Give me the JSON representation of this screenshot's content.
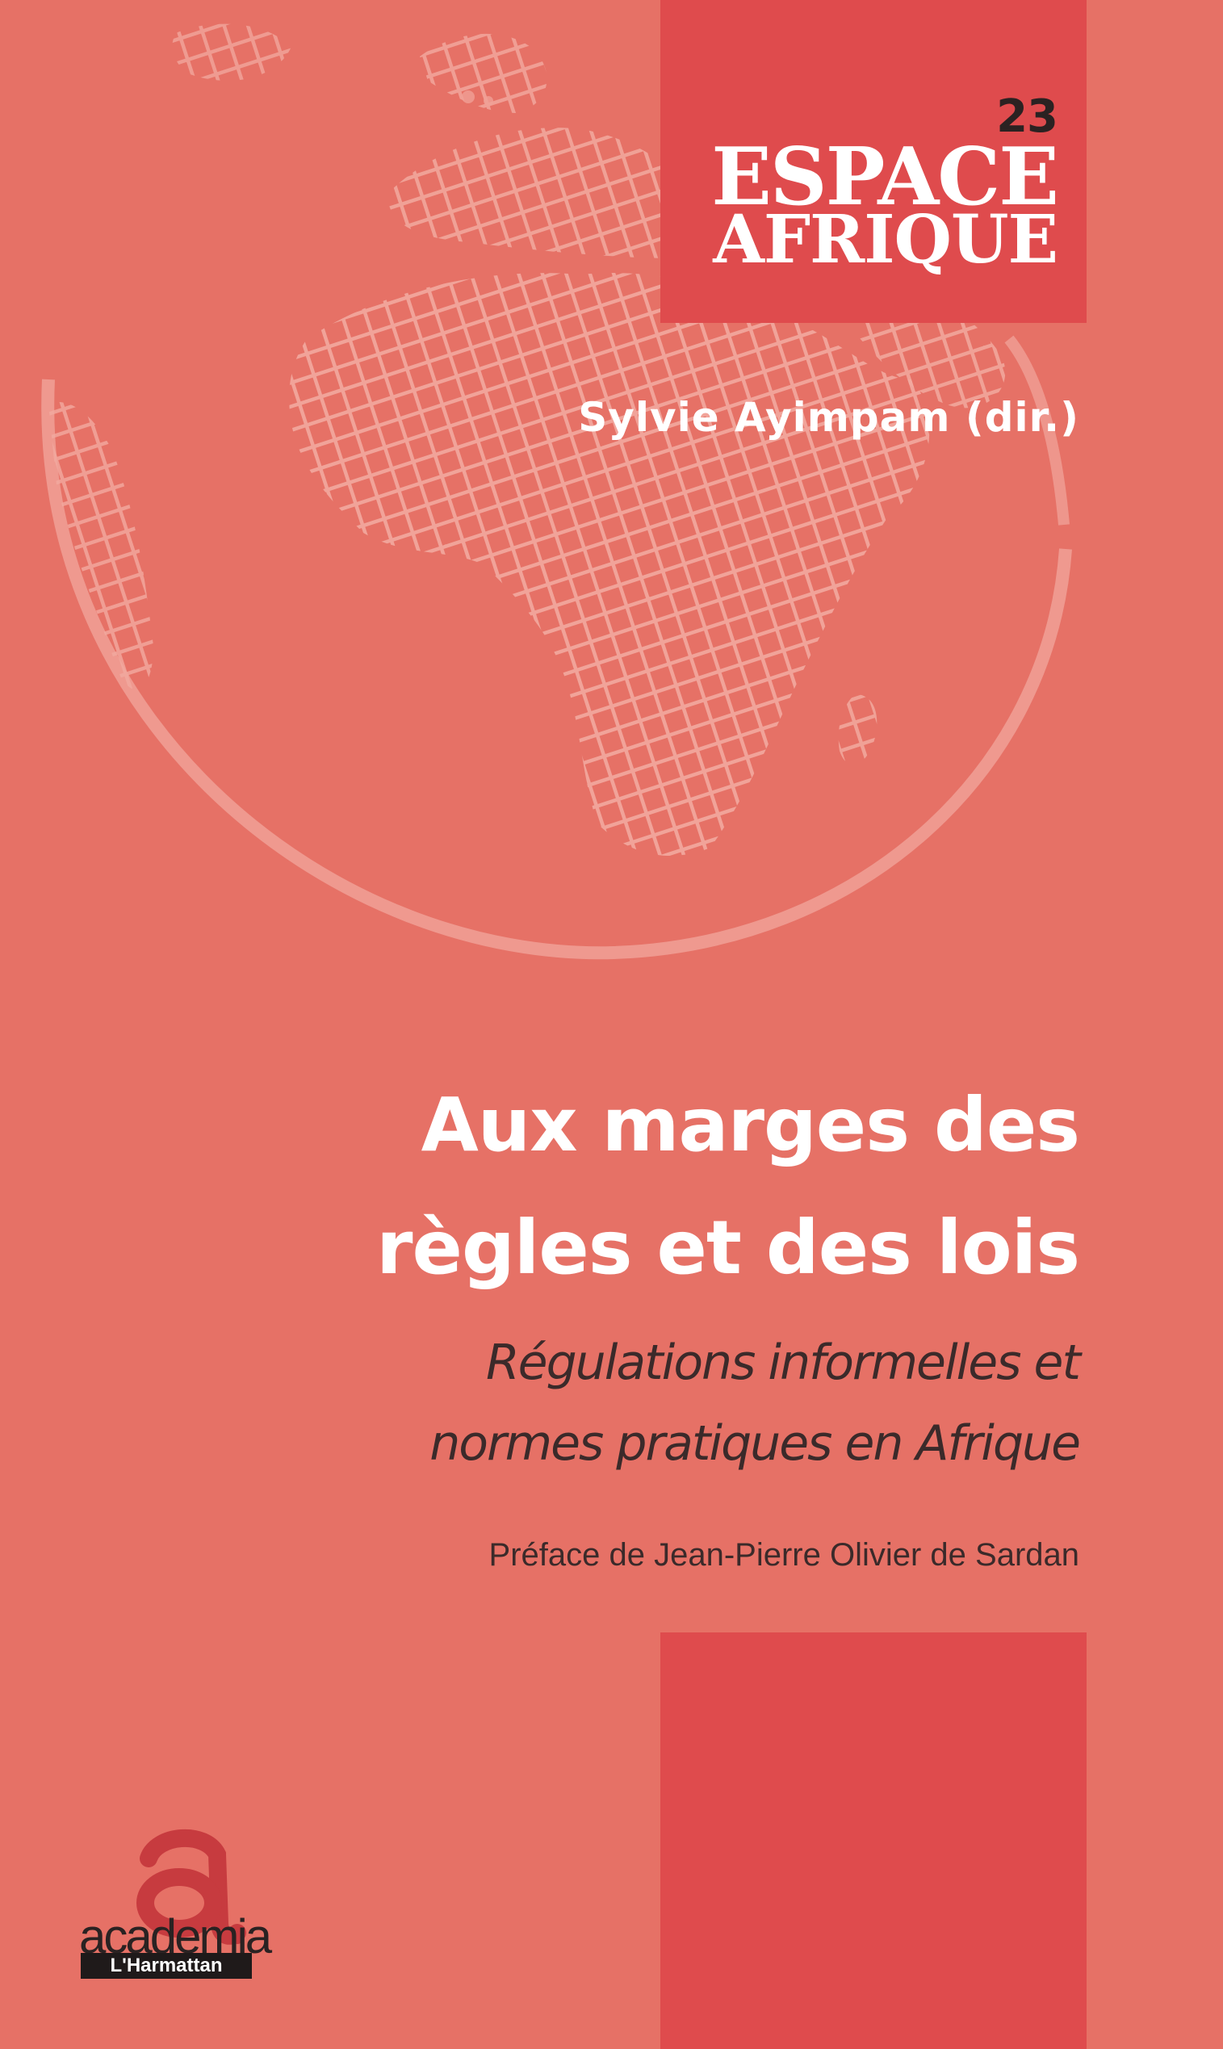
{
  "series": {
    "number": "23",
    "name_line1": "ESPACE",
    "name_line2": "AFRIQUE"
  },
  "author": "Sylvie Ayimpam (dir.)",
  "title": {
    "line1": "Aux marges des",
    "line2": "règles et des lois"
  },
  "subtitle": {
    "line1": "Régulations informelles et",
    "line2": "normes pratiques en Afrique"
  },
  "preface": "Préface de Jean-Pierre Olivier de Sardan",
  "publisher": {
    "name": "academia",
    "imprint": "L'Harmattan"
  },
  "colors": {
    "background": "#e67166",
    "accent_block": "#df4b4d",
    "globe_lines": "#f0a096"
  }
}
